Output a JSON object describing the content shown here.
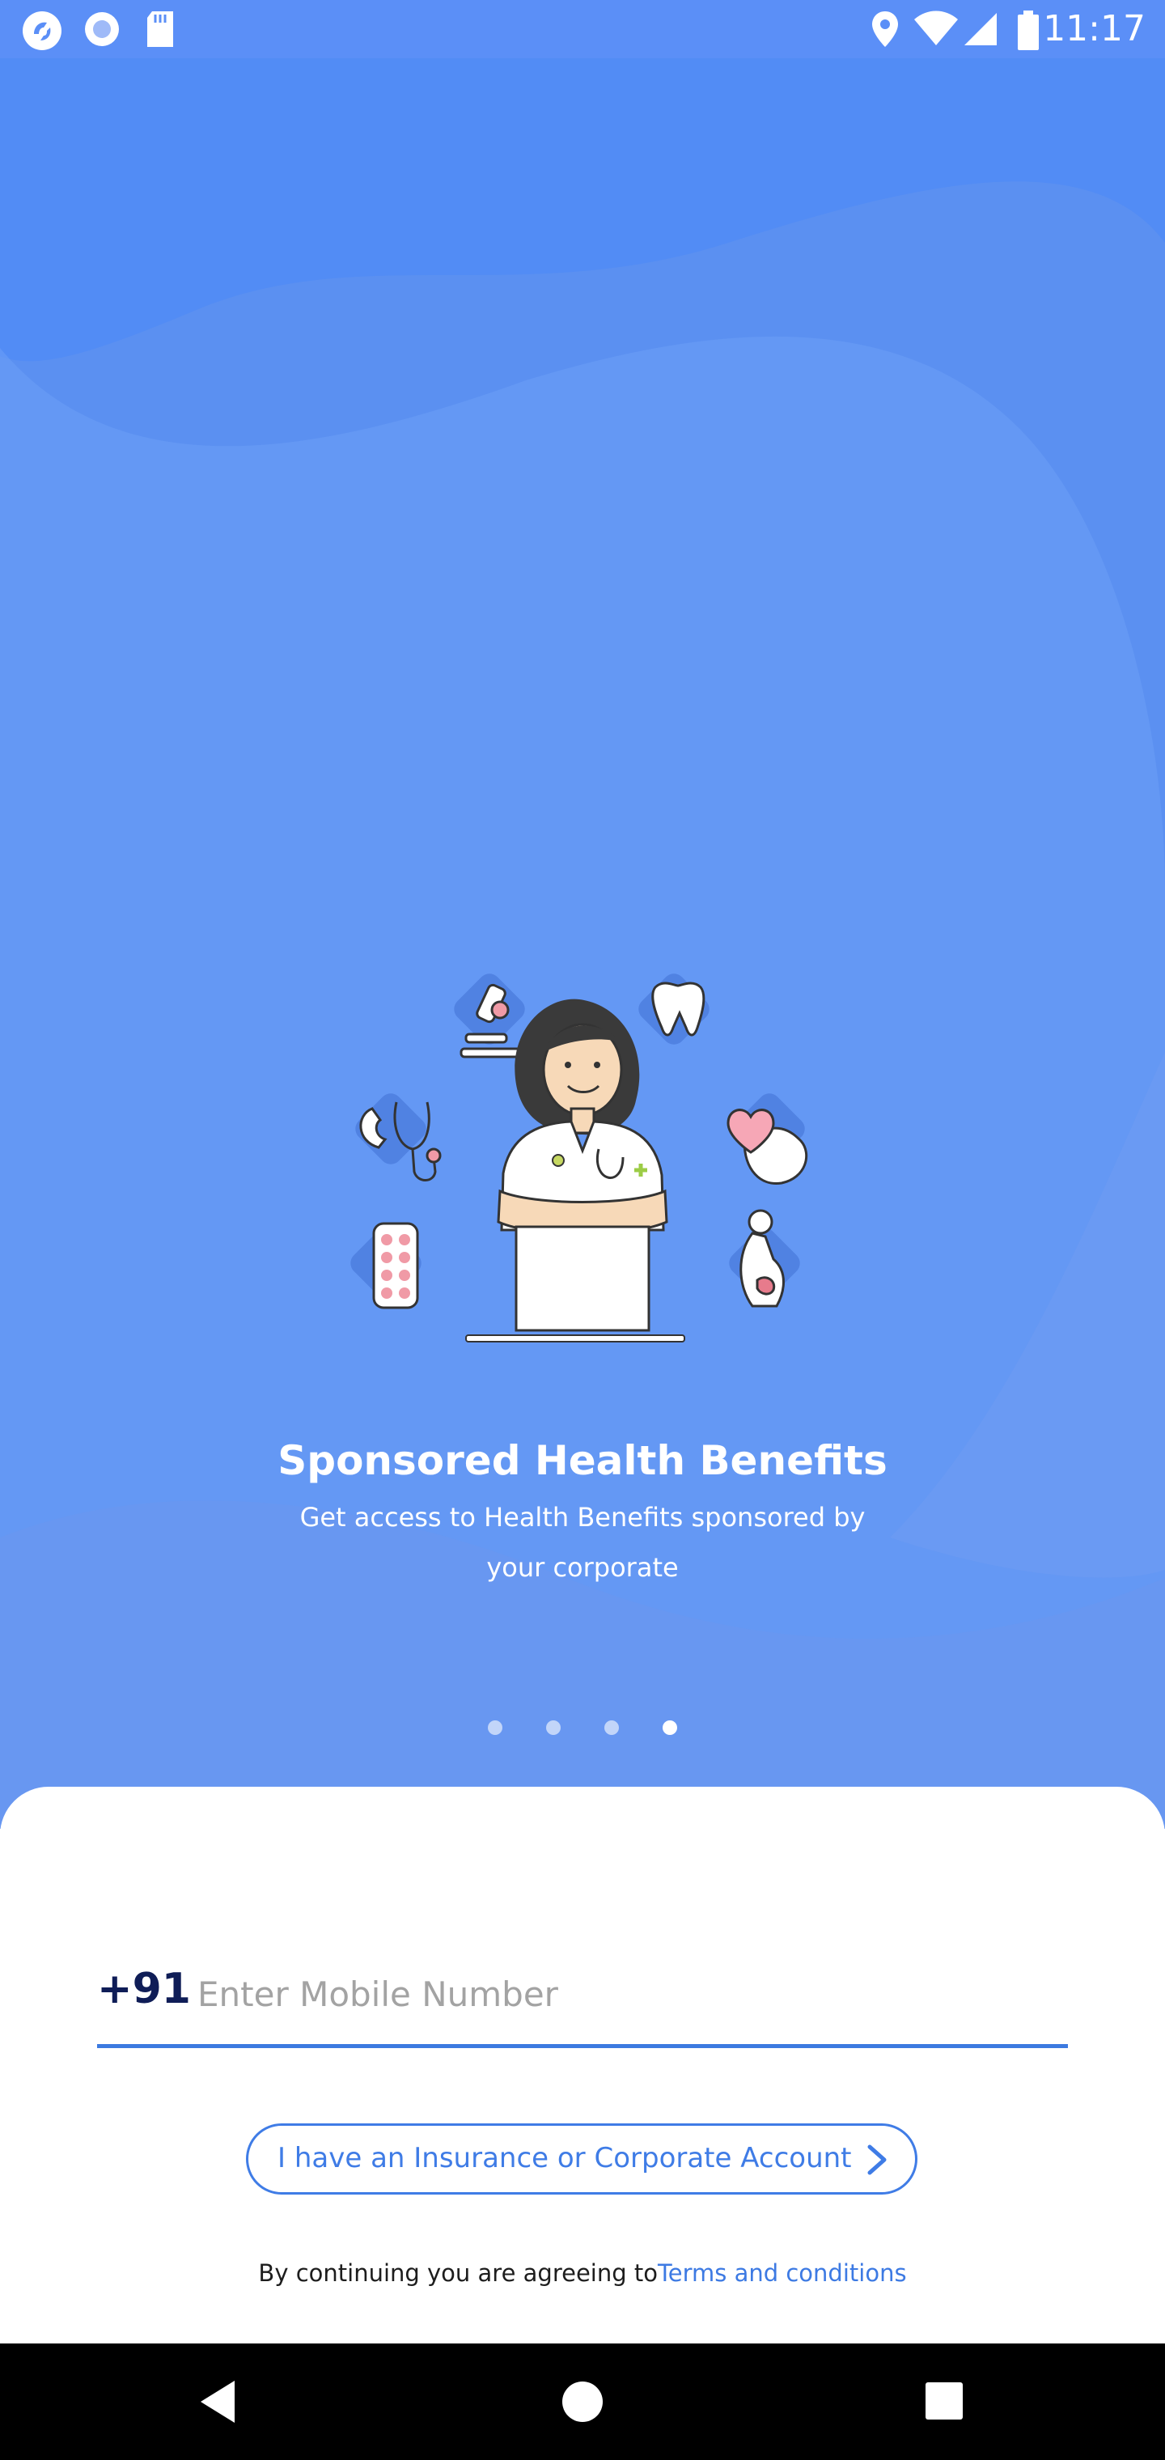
{
  "status_bar": {
    "time": "11:17",
    "left_icons": [
      "app-logo-icon",
      "record-icon",
      "sd-card-icon"
    ],
    "right_icons": [
      "location-icon",
      "wifi-icon",
      "signal-icon",
      "battery-icon"
    ]
  },
  "hero": {
    "title": "Sponsored Health Benefits",
    "subtitle": "Get access to Health Benefits sponsored by your corporate",
    "illustration_icons": [
      "microscope-icon",
      "tooth-icon",
      "stethoscope-phone-icon",
      "heart-brain-icon",
      "pills-icon",
      "pregnancy-icon",
      "doctor-illustration"
    ],
    "carousel": {
      "total": 4,
      "active_index": 3
    }
  },
  "login": {
    "country_code": "+91",
    "phone_placeholder": "Enter Mobile Number",
    "phone_value": "",
    "insurance_button_label": "I have an Insurance or Corporate Account",
    "terms_prefix": "By continuing you are agreeing to",
    "terms_link": "Terms and conditions"
  },
  "nav_bar": {
    "buttons": [
      "back-icon",
      "home-icon",
      "recents-icon"
    ]
  },
  "colors": {
    "hero_background": "#5a8ff2",
    "accent": "#3f7ce6",
    "country_code": "#0f1d57",
    "nav_bar": "#000000"
  }
}
